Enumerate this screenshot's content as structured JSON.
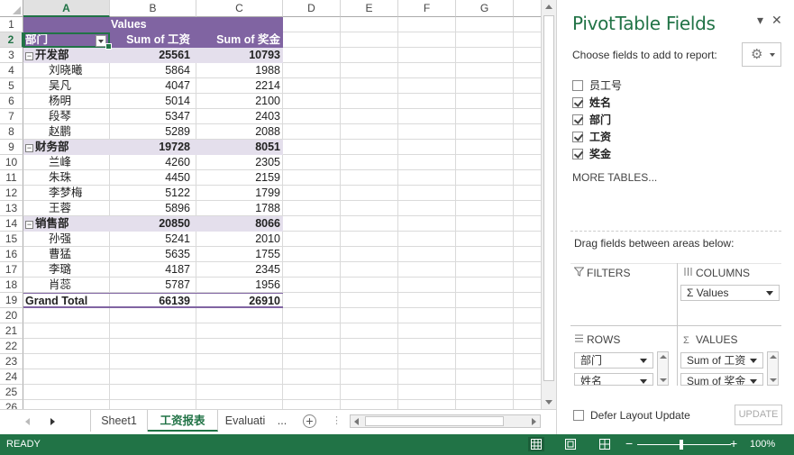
{
  "grid": {
    "columns": [
      "A",
      "B",
      "C",
      "D",
      "E",
      "F",
      "G"
    ],
    "active_column": "A",
    "rows": [
      "1",
      "2",
      "3",
      "4",
      "5",
      "6",
      "7",
      "8",
      "9",
      "10",
      "11",
      "12",
      "13",
      "14",
      "15",
      "16",
      "17",
      "18",
      "19",
      "20",
      "21",
      "22",
      "23",
      "24",
      "25",
      "26"
    ],
    "active_row": "2"
  },
  "pivot": {
    "values_label": "Values",
    "header": {
      "dept": "部门",
      "salary": "Sum of 工资",
      "bonus": "Sum of 奖金"
    },
    "groups": [
      {
        "name": "开发部",
        "salary": "25561",
        "bonus": "10793",
        "members": [
          {
            "name": "刘晓曦",
            "salary": "5864",
            "bonus": "1988"
          },
          {
            "name": "吴凡",
            "salary": "4047",
            "bonus": "2214"
          },
          {
            "name": "杨明",
            "salary": "5014",
            "bonus": "2100"
          },
          {
            "name": "段琴",
            "salary": "5347",
            "bonus": "2403"
          },
          {
            "name": "赵鹏",
            "salary": "5289",
            "bonus": "2088"
          }
        ]
      },
      {
        "name": "财务部",
        "salary": "19728",
        "bonus": "8051",
        "members": [
          {
            "name": "兰峰",
            "salary": "4260",
            "bonus": "2305"
          },
          {
            "name": "朱珠",
            "salary": "4450",
            "bonus": "2159"
          },
          {
            "name": "李梦梅",
            "salary": "5122",
            "bonus": "1799"
          },
          {
            "name": "王蓉",
            "salary": "5896",
            "bonus": "1788"
          }
        ]
      },
      {
        "name": "销售部",
        "salary": "20850",
        "bonus": "8066",
        "members": [
          {
            "name": "孙强",
            "salary": "5241",
            "bonus": "2010"
          },
          {
            "name": "曹猛",
            "salary": "5635",
            "bonus": "1755"
          },
          {
            "name": "李璐",
            "salary": "4187",
            "bonus": "2345"
          },
          {
            "name": "肖蕊",
            "salary": "5787",
            "bonus": "1956"
          }
        ]
      }
    ],
    "grand_total": {
      "label": "Grand Total",
      "salary": "66139",
      "bonus": "26910"
    },
    "collapse_symbol": "−"
  },
  "tabs": {
    "items": [
      "Sheet1",
      "工资报表",
      "Evaluati"
    ],
    "active": "工资报表",
    "overflow": "...",
    "add": "+",
    "separator": "⋮"
  },
  "status": {
    "text": "READY",
    "zoom": "100%",
    "zoom_minus": "−",
    "zoom_plus": "+"
  },
  "pane": {
    "title": "PivotTable Fields",
    "dropdown_glyph": "▾",
    "close_glyph": "✕",
    "subtitle": "Choose fields to add to report:",
    "gear_glyph": "⚙",
    "fields": [
      {
        "label": "员工号",
        "checked": false
      },
      {
        "label": "姓名",
        "checked": true
      },
      {
        "label": "部门",
        "checked": true
      },
      {
        "label": "工资",
        "checked": true
      },
      {
        "label": "奖金",
        "checked": true
      }
    ],
    "more_tables": "MORE TABLES...",
    "hint": "Drag fields between areas below:",
    "areas": {
      "filters": "FILTERS",
      "columns": "COLUMNS",
      "rows": "ROWS",
      "values": "VALUES"
    },
    "columns_items": [
      "Σ Values"
    ],
    "rows_items": [
      "部门",
      "姓名"
    ],
    "values_items": [
      "Sum of 工资",
      "Sum of 奖金"
    ],
    "defer": "Defer Layout Update",
    "update": "UPDATE"
  },
  "colors": {
    "accent": "#217346",
    "pivot_header": "#8064a2",
    "pivot_band": "#e4dfec"
  }
}
